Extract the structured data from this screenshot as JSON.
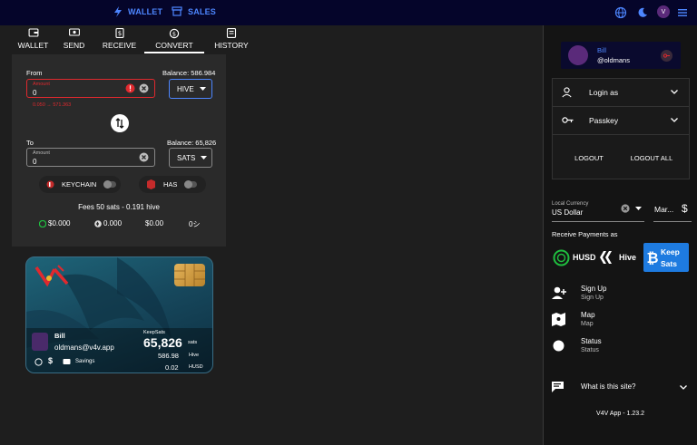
{
  "topbar": {
    "wallet_label": "WALLET",
    "sales_label": "SALES",
    "avatar_initial": "V"
  },
  "tabs": [
    {
      "label": "WALLET"
    },
    {
      "label": "SEND"
    },
    {
      "label": "RECEIVE"
    },
    {
      "label": "CONVERT"
    },
    {
      "label": "HISTORY"
    }
  ],
  "convert": {
    "from_label": "From",
    "from_balance": "Balance: 586.984",
    "from_amount_caption": "Amount",
    "from_amount_value": "0",
    "from_error_hint": "0.050 → 571.363",
    "from_currency": "HIVE",
    "to_label": "To",
    "to_balance": "Balance: 65,826",
    "to_amount_caption": "Amount",
    "to_amount_value": "0",
    "to_currency": "SATS",
    "keychain_label": "KEYCHAIN",
    "has_label": "HAS",
    "fees_text": "Fees 50 sats - 0.191 hive",
    "amounts": [
      "$0.000",
      "0.000",
      "$0.00",
      "0シ"
    ]
  },
  "card": {
    "name": "Bill",
    "handle": "oldmans@v4v.app",
    "savings_label": "Savings",
    "keepsats_label": "KeepSats",
    "sats_value": "65,826",
    "sats_unit": "sats",
    "hive_value": "586.98",
    "hive_unit": "Hive",
    "husd_value": "0.02",
    "husd_unit": "HUSD"
  },
  "sidebar": {
    "user_name": "Bill",
    "user_handle": "@oldmans",
    "login_as": "Login as",
    "passkey": "Passkey",
    "logout": "LOGOUT",
    "logout_all": "LOGOUT ALL",
    "local_currency_caption": "Local Currency",
    "local_currency_value": "US Dollar",
    "market_label": "Mar...",
    "receive_payments_label": "Receive Payments as",
    "husd_option": "HUSD",
    "hive_option": "Hive",
    "keep_option_line1": "Keep",
    "keep_option_line2": "Sats",
    "signup_title": "Sign Up",
    "signup_sub": "Sign Up",
    "map_title": "Map",
    "map_sub": "Map",
    "status_title": "Status",
    "status_sub": "Status",
    "what_is_site": "What is this site?",
    "version": "V4V App - 1.23.2"
  },
  "colors": {
    "topbar_bg": "#05052a",
    "accent_blue": "#4d86ff",
    "error_red": "#e0292e",
    "keep_sats_blue": "#1e7be0",
    "husd_green": "#1fbf3f"
  }
}
